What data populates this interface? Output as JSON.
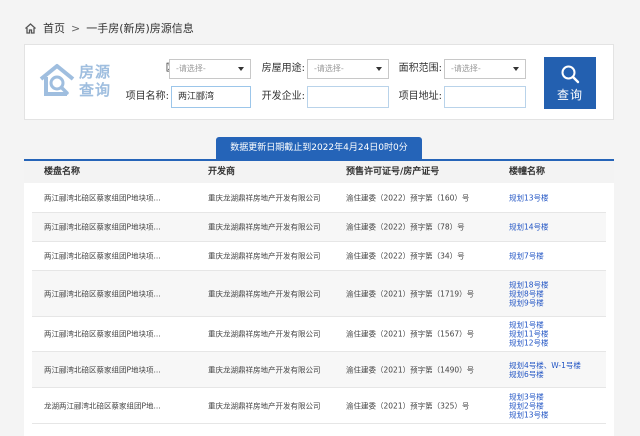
{
  "breadcrumb": {
    "home": "首页",
    "separator": ">",
    "current": "一手房(新房)房源信息"
  },
  "logo": {
    "line1": "房源",
    "line2": "查询"
  },
  "filters": {
    "district_label": "区县:",
    "district_value": "-请选择-",
    "usage_label": "房屋用途:",
    "usage_value": "-请选择-",
    "area_label": "面积范围:",
    "area_value": "-请选择-",
    "project_label": "项目名称:",
    "project_value": "两江郦湾",
    "developer_label": "开发企业:",
    "developer_value": "",
    "address_label": "项目地址:",
    "address_value": ""
  },
  "search_button": "查询",
  "notice": "数据更新日期截止到2022年4月24日0时0分",
  "table": {
    "headers": [
      "楼盘名称",
      "开发商",
      "预售许可证号/房产证号",
      "楼幢名称"
    ],
    "rows": [
      {
        "name": "两江郦湾北碚区蔡家组团P地块项...",
        "developer": "重庆龙湖鼎祥房地产开发有限公司",
        "permit": "渝住建委（2022）预字第（160）号",
        "buildings": [
          "规划13号楼"
        ]
      },
      {
        "name": "两江郦湾北碚区蔡家组团P地块项...",
        "developer": "重庆龙湖鼎祥房地产开发有限公司",
        "permit": "渝住建委（2022）预字第（78）号",
        "buildings": [
          "规划14号楼"
        ]
      },
      {
        "name": "两江郦湾北碚区蔡家组团P地块项...",
        "developer": "重庆龙湖鼎祥房地产开发有限公司",
        "permit": "渝住建委（2022）预字第（34）号",
        "buildings": [
          "规划7号楼"
        ]
      },
      {
        "name": "两江郦湾北碚区蔡家组团P地块项...",
        "developer": "重庆龙湖鼎祥房地产开发有限公司",
        "permit": "渝住建委（2021）预字第（1719）号",
        "buildings": [
          "规划18号楼",
          "规划8号楼",
          "规划9号楼"
        ]
      },
      {
        "name": "两江郦湾北碚区蔡家组团P地块项...",
        "developer": "重庆龙湖鼎祥房地产开发有限公司",
        "permit": "渝住建委（2021）预字第（1567）号",
        "buildings": [
          "规划1号楼",
          "规划11号楼",
          "规划12号楼"
        ]
      },
      {
        "name": "两江郦湾北碚区蔡家组团P地块项...",
        "developer": "重庆龙湖鼎祥房地产开发有限公司",
        "permit": "渝住建委（2021）预字第（1490）号",
        "buildings": [
          "规划4号楼、W-1号楼",
          "规划6号楼"
        ]
      },
      {
        "name": "龙湖两江郦湾北碚区蔡家组团P地...",
        "developer": "重庆龙湖鼎祥房地产开发有限公司",
        "permit": "渝住建委（2021）预字第（325）号",
        "buildings": [
          "规划3号楼",
          "规划2号楼",
          "规划13号楼"
        ]
      }
    ]
  },
  "colors": {
    "primary": "#2564b8",
    "link": "#2255c4",
    "logo": "#9fbedf"
  }
}
